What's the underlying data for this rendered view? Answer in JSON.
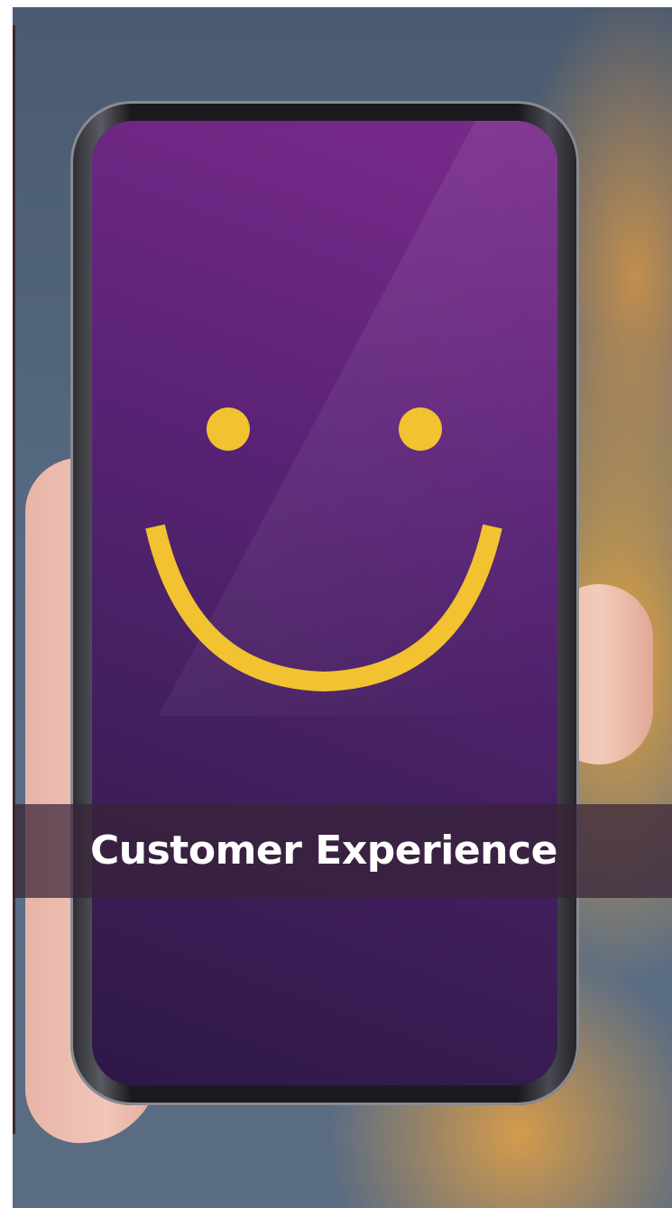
{
  "banner": {
    "title": "Customer Experience"
  },
  "icons": {
    "smiley": "smiley-face-icon"
  },
  "colors": {
    "screen_top": "#7a2a8c",
    "screen_bottom": "#2e1848",
    "smile": "#f2c230",
    "banner_text": "#ffffff"
  }
}
